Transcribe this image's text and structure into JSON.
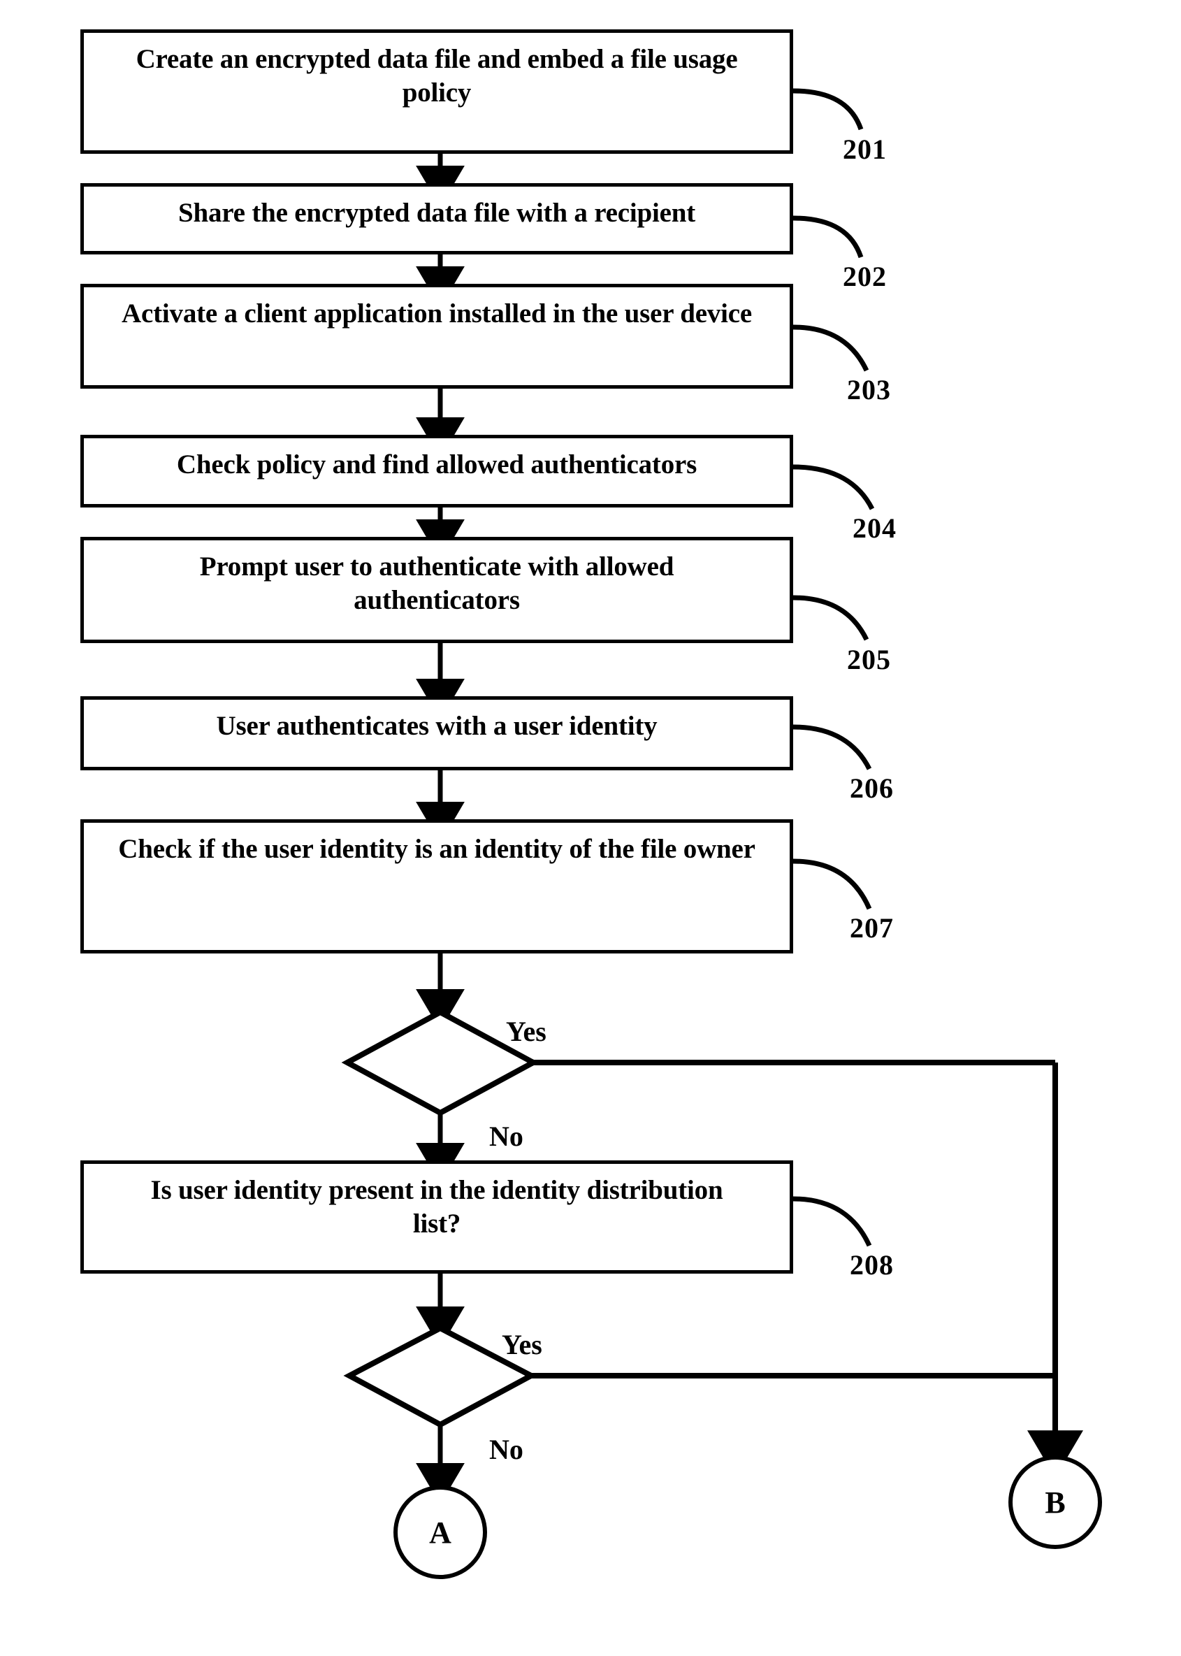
{
  "figure": {
    "type": "flowchart",
    "orientation": "vertical",
    "background_color": "#ffffff",
    "line_color": "#000000"
  },
  "nodes": [
    {
      "id": "step-201",
      "shape": "process",
      "text": "Create an encrypted data file and embed a file usage policy",
      "ref": "201"
    },
    {
      "id": "step-202",
      "shape": "process",
      "text": "Share the encrypted data file with a recipient",
      "ref": "202"
    },
    {
      "id": "step-203",
      "shape": "process",
      "text": "Activate a client application installed in the user device",
      "ref": "203"
    },
    {
      "id": "step-204",
      "shape": "process",
      "text": "Check policy and find allowed authenticators",
      "ref": "204"
    },
    {
      "id": "step-205",
      "shape": "process",
      "text": "Prompt user to authenticate with allowed authenticators",
      "ref": "205"
    },
    {
      "id": "step-206",
      "shape": "process",
      "text": "User authenticates with a user identity",
      "ref": "206"
    },
    {
      "id": "step-207",
      "shape": "process",
      "text": "Check if the user identity is an identity of the file owner",
      "ref": "207"
    },
    {
      "id": "step-208",
      "shape": "process",
      "text": "Is user identity present in the identity distribution list?",
      "ref": "208"
    }
  ],
  "decisions": [
    {
      "id": "decision-owner",
      "yes_label": "Yes",
      "no_label": "No"
    },
    {
      "id": "decision-distribution",
      "yes_label": "Yes",
      "no_label": "No"
    }
  ],
  "connectors": [
    {
      "id": "connector-a",
      "label": "A"
    },
    {
      "id": "connector-b",
      "label": "B"
    }
  ]
}
